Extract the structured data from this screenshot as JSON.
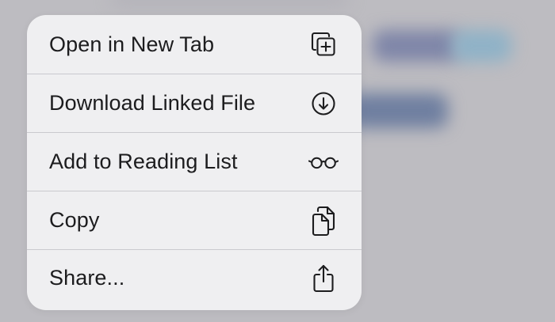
{
  "context_menu": {
    "items": [
      {
        "label": "Open in New Tab",
        "icon": "plus-square-on-square-icon"
      },
      {
        "label": "Download Linked File",
        "icon": "arrow-down-circle-icon"
      },
      {
        "label": "Add to Reading List",
        "icon": "eyeglasses-icon"
      },
      {
        "label": "Copy",
        "icon": "doc-on-doc-icon"
      },
      {
        "label": "Share...",
        "icon": "square-and-arrow-up-icon"
      }
    ]
  },
  "colors": {
    "menu_background": "#efeff1",
    "text": "#1c1c1e",
    "separator": "#c9c9ce",
    "backdrop": "#bdbcc1"
  }
}
